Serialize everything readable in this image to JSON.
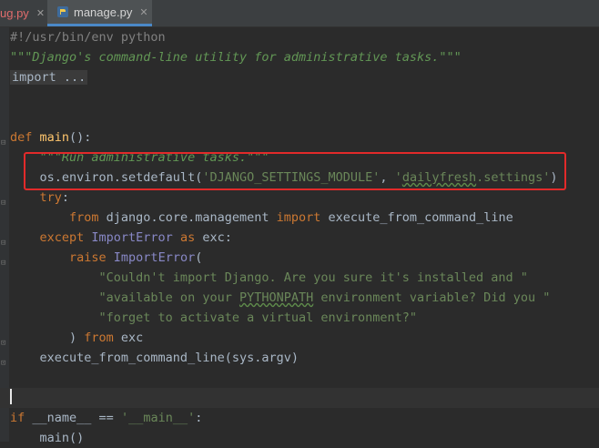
{
  "tabs": [
    {
      "label": "ug.py",
      "active": false,
      "status": "error"
    },
    {
      "label": "manage.py",
      "active": true
    }
  ],
  "code_lines": [
    {
      "parts": [
        {
          "t": "#!/usr/bin/env python",
          "c": "cmt"
        }
      ]
    },
    {
      "parts": [
        {
          "t": "\"\"\"Django's command-line utility for administrative tasks.\"\"\"",
          "c": "doc"
        }
      ]
    },
    {
      "parts": [
        {
          "t": "import ...",
          "c": "import-folded"
        }
      ]
    },
    {
      "parts": []
    },
    {
      "parts": []
    },
    {
      "parts": [
        {
          "t": "def ",
          "c": "kw"
        },
        {
          "t": "main",
          "c": "fn"
        },
        {
          "t": "():",
          "c": ""
        }
      ]
    },
    {
      "parts": [
        {
          "t": "    \"\"\"Run administrative tasks.\"\"\"",
          "c": "doc"
        }
      ]
    },
    {
      "parts": [
        {
          "t": "    os.environ.setdefault(",
          "c": ""
        },
        {
          "t": "'DJANGO_SETTINGS_MODULE'",
          "c": "str"
        },
        {
          "t": ", ",
          "c": ""
        },
        {
          "t": "'dailyfresh.settings'",
          "c": "str"
        },
        {
          "t": ")",
          "c": ""
        }
      ]
    },
    {
      "parts": [
        {
          "t": "    try",
          "c": "kw"
        },
        {
          "t": ":",
          "c": ""
        }
      ]
    },
    {
      "parts": [
        {
          "t": "        from ",
          "c": "kw"
        },
        {
          "t": "django.core.management ",
          "c": ""
        },
        {
          "t": "import ",
          "c": "kw"
        },
        {
          "t": "execute_from_command_line",
          "c": ""
        }
      ]
    },
    {
      "parts": [
        {
          "t": "    except ",
          "c": "kw"
        },
        {
          "t": "ImportError ",
          "c": "cls"
        },
        {
          "t": "as ",
          "c": "kw"
        },
        {
          "t": "exc:",
          "c": ""
        }
      ]
    },
    {
      "parts": [
        {
          "t": "        raise ",
          "c": "kw"
        },
        {
          "t": "ImportError",
          "c": "cls"
        },
        {
          "t": "(",
          "c": ""
        }
      ]
    },
    {
      "parts": [
        {
          "t": "            \"Couldn't import Django. Are you sure it's installed and \"",
          "c": "str"
        }
      ]
    },
    {
      "parts": [
        {
          "t": "            \"available on your PYTHONPATH environment variable? Did you \"",
          "c": "str"
        }
      ]
    },
    {
      "parts": [
        {
          "t": "            \"forget to activate a virtual environment?\"",
          "c": "str"
        }
      ]
    },
    {
      "parts": [
        {
          "t": "        ) ",
          "c": ""
        },
        {
          "t": "from ",
          "c": "kw"
        },
        {
          "t": "exc",
          "c": ""
        }
      ]
    },
    {
      "parts": [
        {
          "t": "    execute_from_command_line(sys.argv)",
          "c": ""
        }
      ]
    },
    {
      "parts": []
    },
    {
      "parts": []
    },
    {
      "parts": [
        {
          "t": "if ",
          "c": "kw"
        },
        {
          "t": "__name__ == ",
          "c": ""
        },
        {
          "t": "'__main__'",
          "c": "str"
        },
        {
          "t": ":",
          "c": ""
        }
      ]
    },
    {
      "parts": [
        {
          "t": "    main()",
          "c": ""
        }
      ]
    }
  ],
  "colors": {
    "background": "#2b2b2b",
    "keyword": "#cc7832",
    "function": "#ffc66d",
    "string": "#6a8759",
    "highlight_box": "#e22a2a"
  }
}
